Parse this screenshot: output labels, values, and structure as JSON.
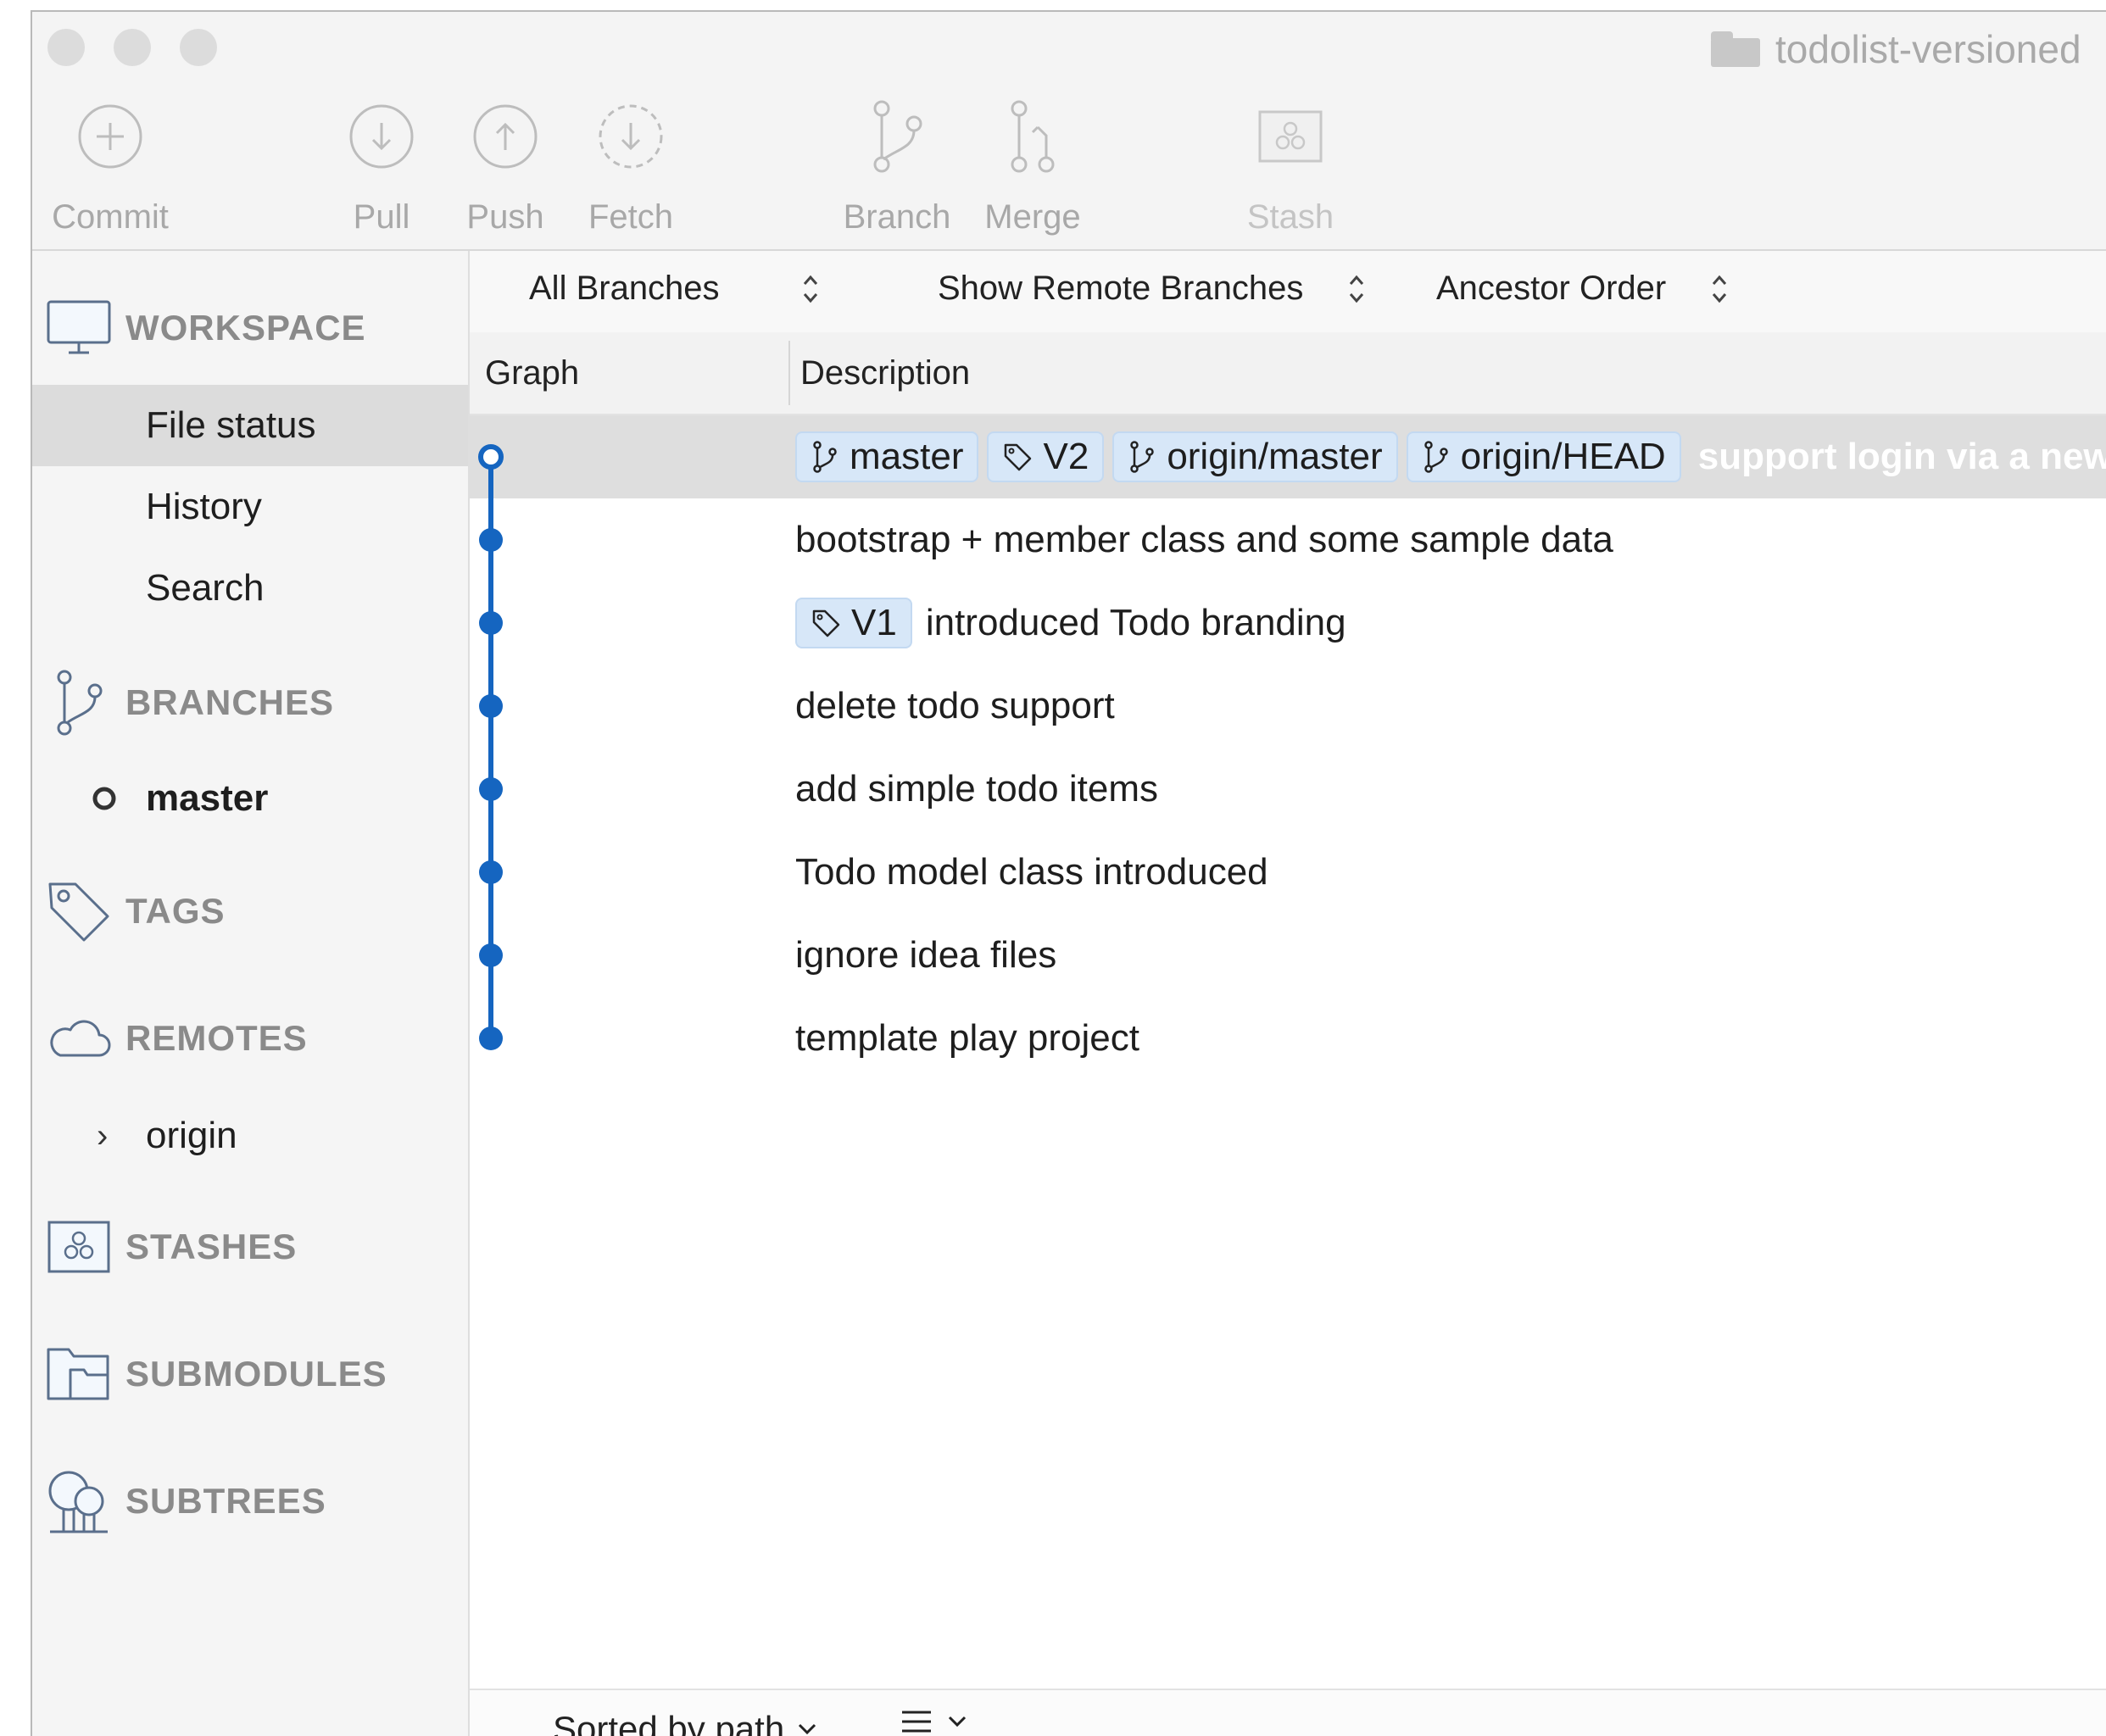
{
  "window": {
    "title": "todolist-versioned"
  },
  "toolbar": {
    "commit": "Commit",
    "pull": "Pull",
    "push": "Push",
    "fetch": "Fetch",
    "branch": "Branch",
    "merge": "Merge",
    "stash": "Stash"
  },
  "sidebar": {
    "workspace": "WORKSPACE",
    "file_status": "File status",
    "history": "History",
    "search": "Search",
    "branches": "BRANCHES",
    "branch_master": "master",
    "tags": "TAGS",
    "remotes": "REMOTES",
    "remote_origin": "origin",
    "stashes": "STASHES",
    "submodules": "SUBMODULES",
    "subtrees": "SUBTREES"
  },
  "filters": {
    "branches": "All Branches",
    "remote": "Show Remote Branches",
    "order": "Ancestor Order"
  },
  "columns": {
    "graph": "Graph",
    "description": "Description"
  },
  "commits": [
    {
      "badges": [
        {
          "kind": "branch",
          "label": "master"
        },
        {
          "kind": "tag",
          "label": "V2"
        },
        {
          "kind": "branch",
          "label": "origin/master"
        },
        {
          "kind": "branch",
          "label": "origin/HEAD"
        }
      ],
      "message": "support login via a new"
    },
    {
      "badges": [],
      "message": "bootstrap + member class and some sample data"
    },
    {
      "badges": [
        {
          "kind": "tag",
          "label": "V1"
        }
      ],
      "message": "introduced Todo branding"
    },
    {
      "badges": [],
      "message": "delete todo support"
    },
    {
      "badges": [],
      "message": "add simple todo items"
    },
    {
      "badges": [],
      "message": "Todo model class introduced"
    },
    {
      "badges": [],
      "message": "ignore idea files"
    },
    {
      "badges": [],
      "message": "template play project"
    }
  ],
  "bottom": {
    "sort": "Sorted by path"
  },
  "colors": {
    "graph_blue": "#1565c0",
    "badge_bg": "#d7e7f8",
    "selection": "#dedede"
  }
}
